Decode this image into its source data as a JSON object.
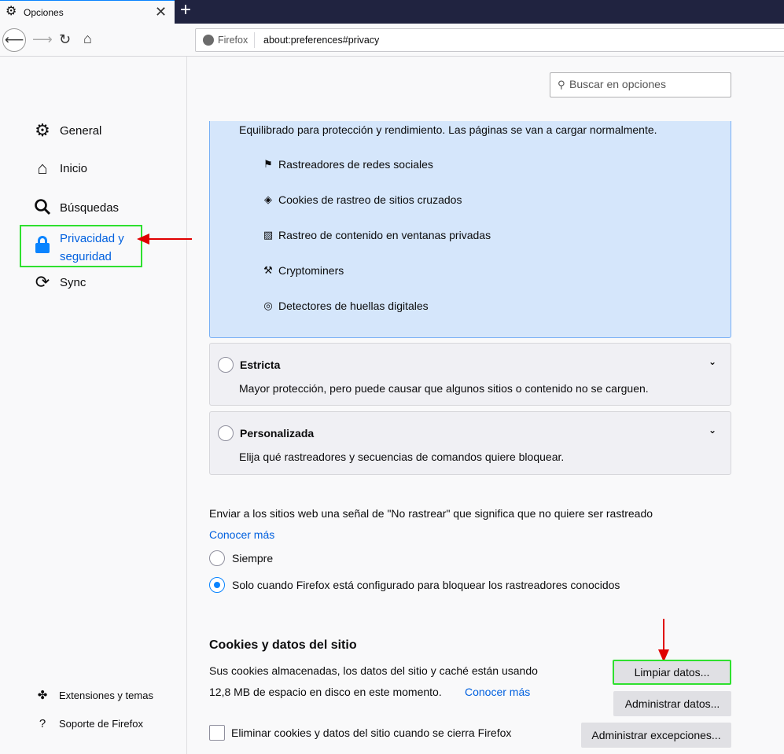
{
  "tab": {
    "title": "Opciones",
    "close_glyph": "✕",
    "new_tab_glyph": "+"
  },
  "nav": {
    "identity_label": "Firefox",
    "url": "about:preferences#privacy"
  },
  "sidebar": {
    "items": [
      {
        "label": "General"
      },
      {
        "label": "Inicio"
      },
      {
        "label": "Búsquedas"
      },
      {
        "label": "Privacidad y seguridad"
      },
      {
        "label": "Sync"
      }
    ],
    "footer": [
      {
        "label": "Extensiones y temas"
      },
      {
        "label": "Soporte de Firefox"
      }
    ]
  },
  "search": {
    "placeholder": "Buscar en opciones"
  },
  "standard": {
    "description": "Equilibrado para protección y rendimiento. Las páginas se van a cargar normalmente.",
    "trackers": [
      {
        "label": "Rastreadores de redes sociales",
        "icon": "social-tracker-icon"
      },
      {
        "label": "Cookies de rastreo de sitios cruzados",
        "icon": "cookie-icon"
      },
      {
        "label": "Rastreo de contenido en ventanas privadas",
        "icon": "content-tracker-icon"
      },
      {
        "label": "Cryptominers",
        "icon": "cryptominer-icon"
      },
      {
        "label": "Detectores de huellas digitales",
        "icon": "fingerprint-icon"
      }
    ]
  },
  "strict": {
    "title": "Estricta",
    "description": "Mayor protección, pero puede causar que algunos sitios o contenido no se carguen."
  },
  "custom": {
    "title": "Personalizada",
    "description": "Elija qué rastreadores y secuencias de comandos quiere bloquear."
  },
  "dnt": {
    "text": "Enviar a los sitios web una señal de \"No rastrear\" que significa que no quiere ser rastreado",
    "learn_more": "Conocer más",
    "options": [
      {
        "label": "Siempre",
        "checked": false
      },
      {
        "label": "Solo cuando Firefox está configurado para bloquear los rastreadores conocidos",
        "checked": true
      }
    ]
  },
  "cookies": {
    "title": "Cookies y datos del sitio",
    "desc_line1": "Sus cookies almacenadas, los datos del sitio y caché están usando",
    "desc_line2": "12,8 MB de espacio en disco en este momento.",
    "learn_more": "Conocer más",
    "clear_button": "Limpiar datos...",
    "manage_button": "Administrar datos...",
    "exceptions_button": "Administrar excepciones...",
    "delete_on_close": "Eliminar cookies y datos del sitio cuando se cierra Firefox"
  },
  "colors": {
    "highlight": "#2fe02f",
    "arrow": "#e00000",
    "accent": "#0a84ff",
    "link": "#0060df"
  }
}
